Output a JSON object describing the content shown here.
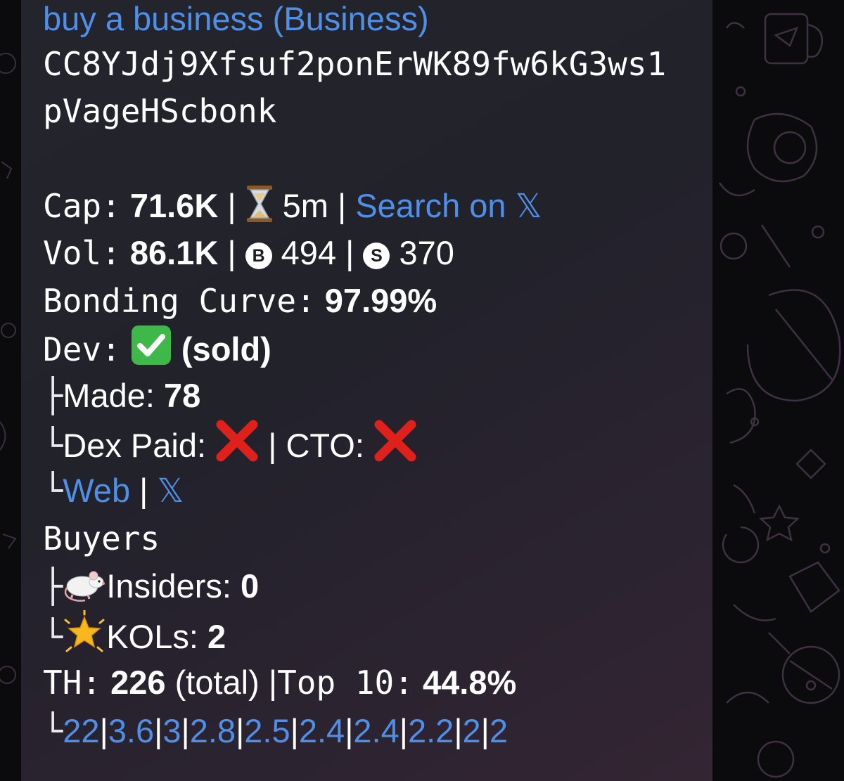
{
  "message": {
    "title": "buy a business (Business)",
    "address_line1": "CC8YJdj9Xfsuf2ponErWK89fw6kG3ws1",
    "address_line2": "pVageHScbonk",
    "cap": {
      "label": "Cap:",
      "value": "71.6K",
      "age": "5m",
      "search_link": "Search on",
      "x_glyph": "𝕏"
    },
    "vol": {
      "label": "Vol:",
      "value": "86.1K",
      "buys_glyph": "B",
      "buys": "494",
      "sells_glyph": "S",
      "sells": "370"
    },
    "bonding": {
      "label": "Bonding Curve:",
      "value": "97.99%"
    },
    "dev": {
      "label": "Dev:",
      "status": "(sold)",
      "made_label": "Made:",
      "made_value": "78",
      "dex_paid_label": "Dex Paid:",
      "cto_label": "CTO:",
      "web_link": "Web",
      "x_glyph": "𝕏"
    },
    "buyers": {
      "label": "Buyers",
      "insiders_label": "Insiders:",
      "insiders_value": "0",
      "kols_label": "KOLs:",
      "kols_value": "2"
    },
    "holders": {
      "label": "TH:",
      "total_value": "226",
      "total_suffix": "(total)",
      "top10_label": "Top 10:",
      "top10_value": "44.8%",
      "breakdown": [
        "22",
        "3.6",
        "3",
        "2.8",
        "2.5",
        "2.4",
        "2.4",
        "2.2",
        "2",
        "2"
      ]
    },
    "tree_glyphs": {
      "branch": "├",
      "end": "└"
    },
    "separator": "|"
  },
  "icons": {
    "age": "hourglass-icon",
    "buys": "b-circle-icon",
    "sells": "s-circle-icon",
    "dev_ok": "check-box-icon",
    "dex_paid": "red-cross-icon",
    "cto": "red-cross-icon",
    "insiders": "rat-icon",
    "kols": "glowing-star-icon"
  },
  "colors": {
    "link": "#4f8fe8",
    "text": "#ffffff",
    "check": "#3fb84a",
    "cross": "#e0201b"
  }
}
